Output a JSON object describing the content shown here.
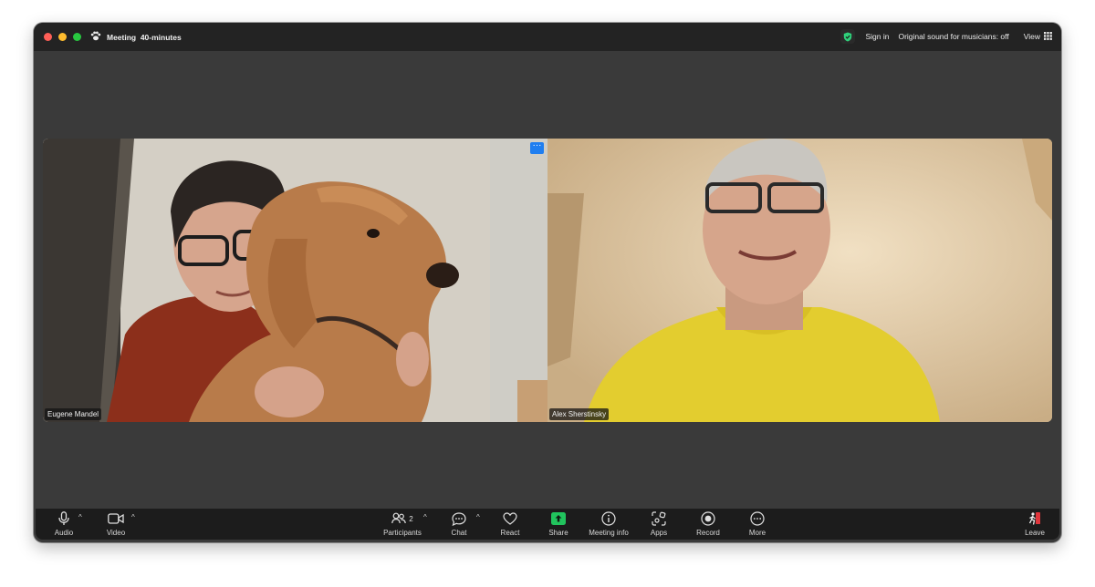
{
  "titlebar": {
    "meeting_title": "Meeting  40-minutes",
    "sign_in": "Sign in",
    "original_sound": "Original sound for musicians: off",
    "view": "View"
  },
  "participants": [
    {
      "name": "Eugene Mandel"
    },
    {
      "name": "Alex Sherstinsky"
    }
  ],
  "toolbar": {
    "audio": "Audio",
    "video": "Video",
    "participants": "Participants",
    "participants_count": "2",
    "chat": "Chat",
    "react": "React",
    "share": "Share",
    "meeting_info": "Meeting info",
    "apps": "Apps",
    "record": "Record",
    "more": "More",
    "leave": "Leave"
  },
  "colors": {
    "share_green": "#21c35d",
    "secure_green": "#2fd07a",
    "leave_red": "#e0363c",
    "tile_menu_blue": "#1f7ef0"
  }
}
